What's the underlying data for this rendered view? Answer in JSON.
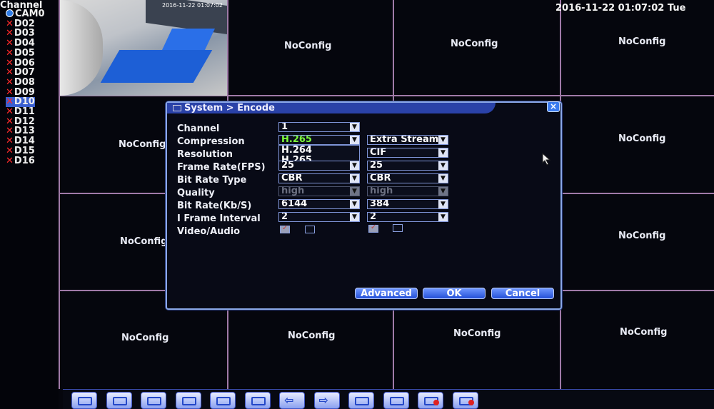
{
  "channel_list": {
    "header": "Channel",
    "items": [
      {
        "label": "CAM0",
        "status": "online"
      },
      {
        "label": "D02",
        "status": "offline"
      },
      {
        "label": "D03",
        "status": "offline"
      },
      {
        "label": "D04",
        "status": "offline"
      },
      {
        "label": "D05",
        "status": "offline"
      },
      {
        "label": "D06",
        "status": "offline"
      },
      {
        "label": "D07",
        "status": "offline"
      },
      {
        "label": "D08",
        "status": "offline"
      },
      {
        "label": "D09",
        "status": "offline"
      },
      {
        "label": "D10",
        "status": "offline",
        "selected": true
      },
      {
        "label": "D11",
        "status": "offline"
      },
      {
        "label": "D12",
        "status": "offline"
      },
      {
        "label": "D13",
        "status": "offline"
      },
      {
        "label": "D14",
        "status": "offline"
      },
      {
        "label": "D15",
        "status": "offline"
      },
      {
        "label": "D16",
        "status": "offline"
      }
    ]
  },
  "clock": "2016-11-22 01:07:02 Tue",
  "camera_preview": {
    "timestamp": "2016-11-22 01:07:02"
  },
  "grid_placeholder": "NoConfig",
  "dialog": {
    "title": "System > Encode",
    "close_glyph": "×",
    "labels": {
      "channel": "Channel",
      "compression": "Compression",
      "resolution": "Resolution",
      "frame_rate": "Frame Rate(FPS)",
      "bit_rate_type": "Bit Rate Type",
      "quality": "Quality",
      "bit_rate": "Bit Rate(Kb/S)",
      "iframe_interval": "I Frame Interval",
      "video_audio": "Video/Audio"
    },
    "main_stream": {
      "channel": "1",
      "compression": "H.265",
      "frame_rate": "25",
      "bit_rate_type": "CBR",
      "quality": "high",
      "bit_rate": "6144",
      "iframe_interval": "2",
      "video": true,
      "audio": false
    },
    "compression_options": [
      "H.264",
      "H.265"
    ],
    "extra_stream": {
      "stream": "Extra Stream",
      "resolution": "CIF",
      "frame_rate": "25",
      "bit_rate_type": "CBR",
      "quality": "high",
      "bit_rate": "384",
      "iframe_interval": "2",
      "video": true,
      "audio": false
    },
    "buttons": {
      "advanced": "Advanced",
      "ok": "OK",
      "cancel": "Cancel"
    }
  },
  "taskbar": {
    "icons": [
      "view-1-icon",
      "view-4-icon",
      "view-8-icon",
      "view-9-icon",
      "view-16-icon",
      "fullscreen-icon",
      "prev-icon",
      "next-icon",
      "playback-icon",
      "network-icon",
      "record-icon",
      "record-stop-icon"
    ],
    "arrow_left": "⇦",
    "arrow_right": "⇨"
  },
  "colors": {
    "accent": "#2a42a8",
    "grid_line": "#a07aa8",
    "offline_x": "#ff2a2a",
    "selected_codec": "#7cff3a"
  }
}
